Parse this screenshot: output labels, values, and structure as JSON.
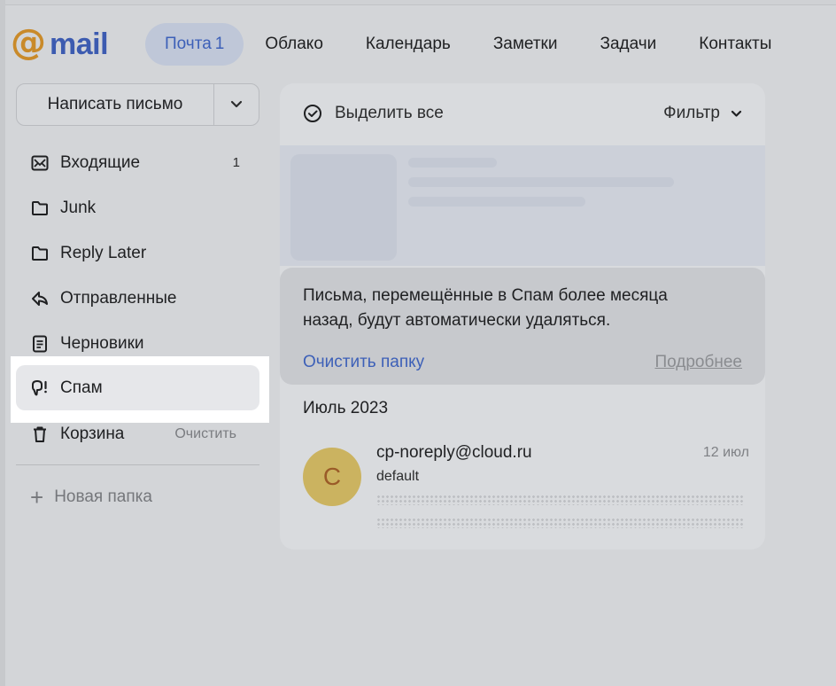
{
  "header": {
    "logo_at": "@",
    "logo_text": "mail",
    "nav": [
      {
        "label": "Почта",
        "count": "1",
        "active": true
      },
      {
        "label": "Облако"
      },
      {
        "label": "Календарь"
      },
      {
        "label": "Заметки"
      },
      {
        "label": "Задачи"
      },
      {
        "label": "Контакты"
      }
    ]
  },
  "sidebar": {
    "compose_label": "Написать письмо",
    "folders": [
      {
        "label": "Входящие",
        "badge": "1",
        "icon": "inbox-icon"
      },
      {
        "label": "Junk",
        "icon": "folder-icon"
      },
      {
        "label": "Reply Later",
        "icon": "folder-icon"
      },
      {
        "label": "Отправленные",
        "icon": "sent-icon"
      },
      {
        "label": "Черновики",
        "icon": "drafts-icon"
      },
      {
        "label": "Спам",
        "icon": "spam-icon",
        "selected": true
      },
      {
        "label": "Корзина",
        "action": "Очистить",
        "icon": "trash-icon"
      }
    ],
    "new_folder_label": "Новая папка"
  },
  "main": {
    "select_all_label": "Выделить все",
    "filter_label": "Фильтр",
    "notice": {
      "text_line1": "Письма, перемещённые в Спам более месяца",
      "text_line2": "назад, будут автоматически удаляться.",
      "clean_label": "Очистить папку",
      "more_label": "Подробнее"
    },
    "month_label": "Июль 2023",
    "messages": [
      {
        "avatar_letter": "C",
        "sender": "cp-noreply@cloud.ru",
        "date": "12 июл",
        "subject": "default"
      }
    ]
  },
  "colors": {
    "accent": "#3d60b8",
    "logo_at": "#c98a2a",
    "avatar_bg": "#cbb360",
    "highlight": "#ffffff"
  }
}
